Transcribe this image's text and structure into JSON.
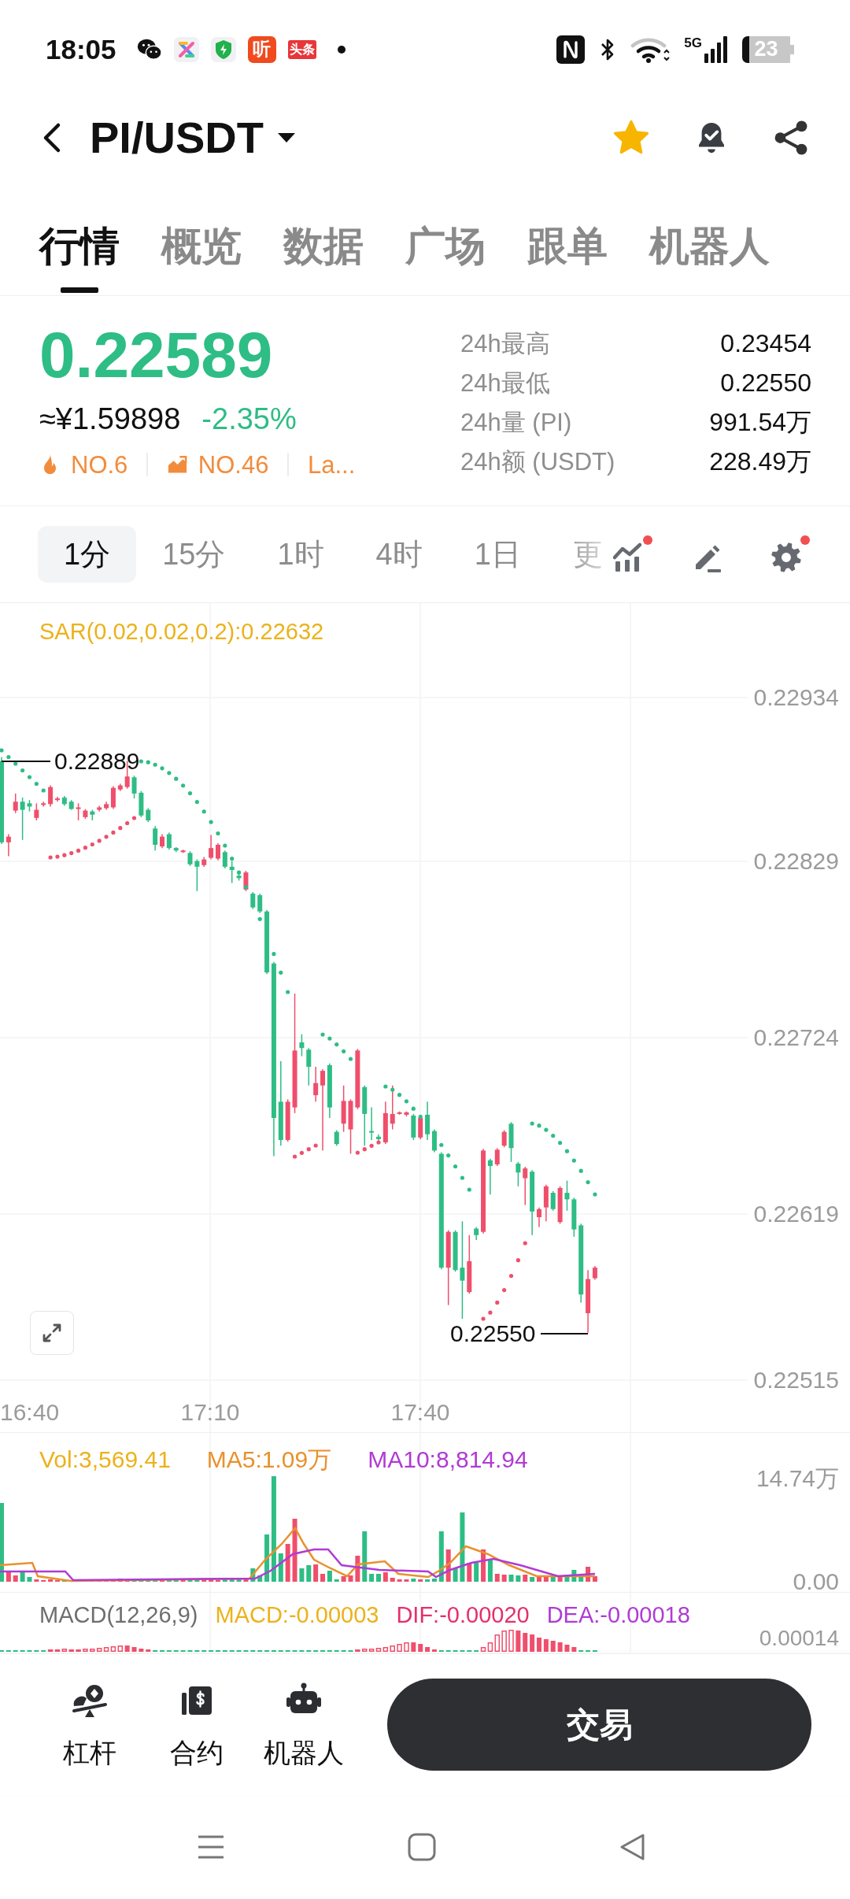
{
  "status_bar": {
    "time": "18:05",
    "notification_badges": [
      "听",
      "头条"
    ],
    "network": "5G",
    "battery": "23"
  },
  "header": {
    "pair": "PI/USDT",
    "favorited": true
  },
  "tabs": [
    {
      "label": "行情",
      "selected": true
    },
    {
      "label": "概览",
      "selected": false
    },
    {
      "label": "数据",
      "selected": false
    },
    {
      "label": "广场",
      "selected": false
    },
    {
      "label": "跟单",
      "selected": false
    },
    {
      "label": "机器人",
      "selected": false
    }
  ],
  "ticker": {
    "price": "0.22589",
    "fiat_price": "≈¥1.59898",
    "change": "-2.35%",
    "rankings": [
      {
        "kind": "hot",
        "label": "NO.6"
      },
      {
        "kind": "gainers",
        "label": "NO.46"
      },
      {
        "kind": "plain",
        "label": "La..."
      }
    ],
    "stats": [
      {
        "label": "24h最高",
        "value": "0.23454"
      },
      {
        "label": "24h最低",
        "value": "0.22550"
      },
      {
        "label": "24h量 (PI)",
        "value": "991.54万"
      },
      {
        "label": "24h额 (USDT)",
        "value": "228.49万"
      }
    ]
  },
  "intervals": [
    {
      "label": "1分",
      "selected": true,
      "faded": false
    },
    {
      "label": "15分",
      "selected": false,
      "faded": false
    },
    {
      "label": "1时",
      "selected": false,
      "faded": false
    },
    {
      "label": "4时",
      "selected": false,
      "faded": false
    },
    {
      "label": "1日",
      "selected": false,
      "faded": false
    },
    {
      "label": "更",
      "selected": false,
      "faded": true
    }
  ],
  "chart_tools": [
    {
      "kind": "indicators",
      "dot": true
    },
    {
      "kind": "draw",
      "dot": false
    },
    {
      "kind": "settings",
      "dot": true
    }
  ],
  "price_chart": {
    "indicator": "SAR(0.02,0.02,0.2):0.22632",
    "price_axis": [
      "0.22934",
      "0.22829",
      "0.22724",
      "0.22619",
      "0.22515"
    ],
    "high_marker": "0.22889",
    "low_marker": "0.22550",
    "time_axis": [
      "16:40",
      "17:10",
      "17:40"
    ]
  },
  "volume": {
    "legend": [
      {
        "label": "Vol:3,569.41",
        "color": "#ebb21b"
      },
      {
        "label": "MA5:1.09万",
        "color": "#e8912d"
      },
      {
        "label": "MA10:8,814.94",
        "color": "#b03bd4"
      }
    ],
    "axis": [
      "14.74万",
      "0.00"
    ]
  },
  "macd": {
    "legend": [
      {
        "label": "MACD(12,26,9)",
        "color": "#6e6e6e"
      },
      {
        "label": "MACD:-0.00003",
        "color": "#ebb21b"
      },
      {
        "label": "DIF:-0.00020",
        "color": "#e5306b"
      },
      {
        "label": "DEA:-0.00018",
        "color": "#b03bd4"
      }
    ],
    "axis": [
      "0.00014"
    ]
  },
  "bottom_bar": {
    "shortcuts": [
      {
        "kind": "margin",
        "label": "杠杆"
      },
      {
        "kind": "futures",
        "label": "合约"
      },
      {
        "kind": "bot",
        "label": "机器人"
      }
    ],
    "trade_button": "交易"
  }
}
